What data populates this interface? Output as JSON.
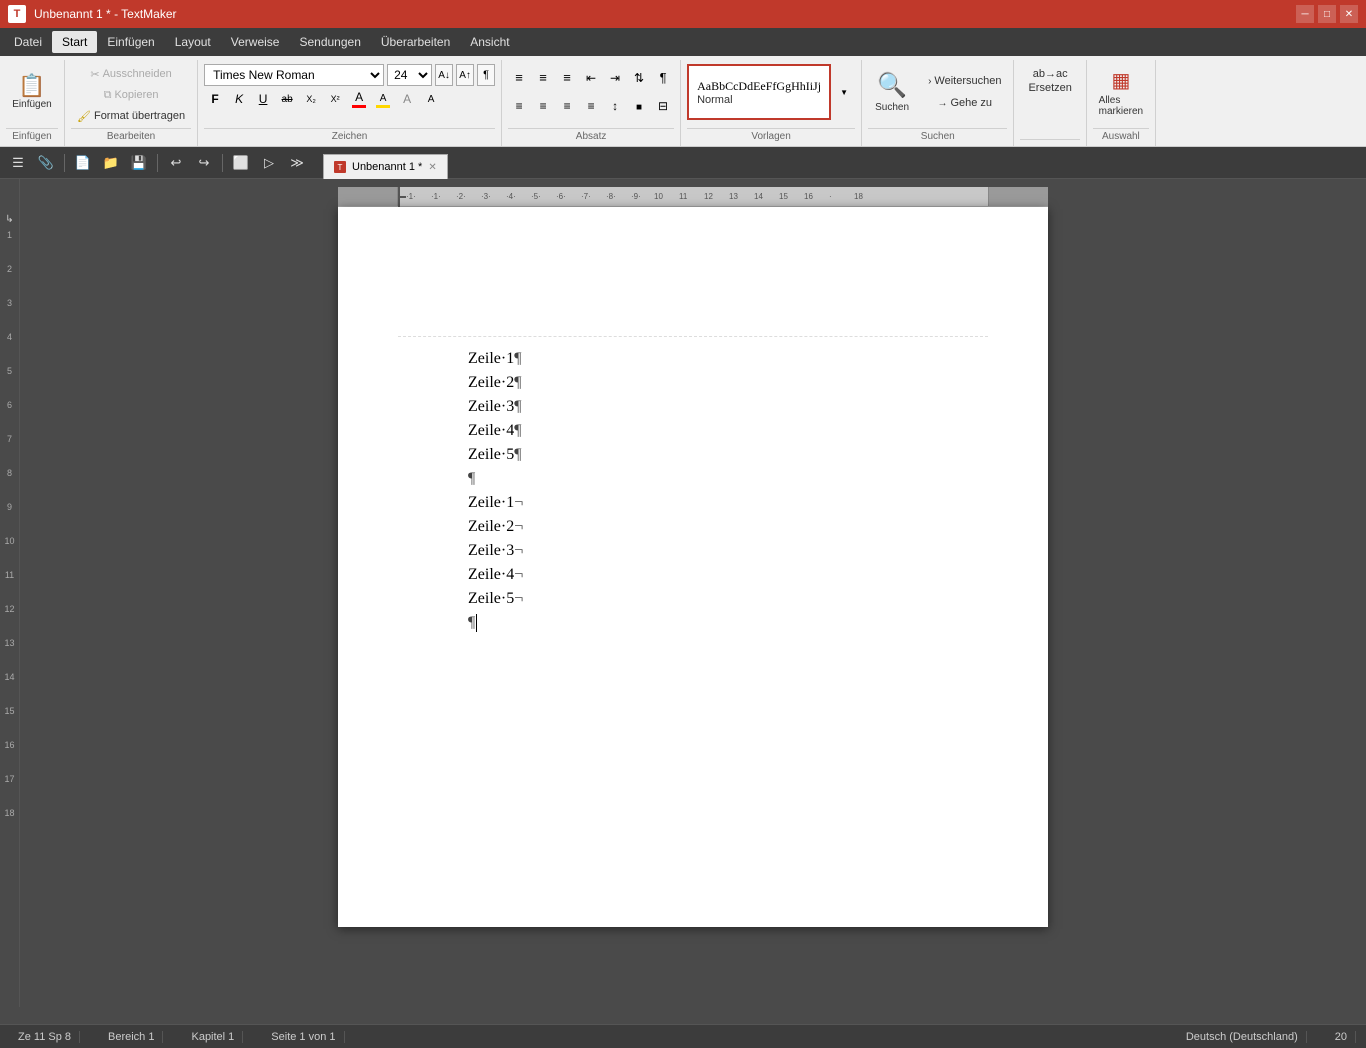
{
  "titleBar": {
    "appIcon": "T",
    "title": "Unbenannt 1 * - TextMaker",
    "minBtn": "─",
    "maxBtn": "□",
    "closeBtn": "✕"
  },
  "menuBar": {
    "items": [
      "Datei",
      "Start",
      "Einfügen",
      "Layout",
      "Verweise",
      "Sendungen",
      "Überarbeiten",
      "Ansicht"
    ],
    "activeIndex": 1
  },
  "ribbon": {
    "groups": [
      {
        "label": "Einfügen",
        "buttons": [
          {
            "icon": "📋",
            "label": "Einfügen"
          }
        ]
      },
      {
        "label": "Bearbeiten",
        "buttons": [
          {
            "label": "Ausschneiden",
            "disabled": true
          },
          {
            "label": "Kopieren",
            "disabled": true
          },
          {
            "label": "Format übertragen"
          }
        ]
      },
      {
        "label": "Zeichen",
        "fontName": "Times New Roman",
        "fontSize": "24",
        "formatButtons": [
          "F",
          "K",
          "U",
          "ab",
          "X₂",
          "X²",
          "A",
          "A",
          "A"
        ]
      },
      {
        "label": "Absatz",
        "alignButtons": [
          "≡",
          "≡",
          "≡",
          "≡"
        ]
      },
      {
        "label": "Vorlagen",
        "previewText": "AaBbCcDdEeFfGgHhIiJj",
        "previewLabel": "Normal"
      },
      {
        "label": "Suchen",
        "buttons": [
          "Suchen",
          "Weitersuchen",
          "Gehe zu"
        ]
      },
      {
        "label": "Auswahl",
        "buttons": [
          "Alles markieren"
        ]
      }
    ]
  },
  "toolbar": {
    "buttons": [
      "☰",
      "📎",
      "📄",
      "📁",
      "💾",
      "↩",
      "↪",
      "⬜",
      "▷",
      "≫"
    ]
  },
  "tabBar": {
    "tabs": [
      {
        "label": "Unbenannt 1 *",
        "active": true
      }
    ]
  },
  "document": {
    "lines": [
      {
        "text": "Zeile·1¶",
        "type": "pilcrow"
      },
      {
        "text": "Zeile·2¶",
        "type": "pilcrow"
      },
      {
        "text": "Zeile·3¶",
        "type": "pilcrow"
      },
      {
        "text": "Zeile·4¶",
        "type": "pilcrow"
      },
      {
        "text": "Zeile·5¶",
        "type": "pilcrow"
      },
      {
        "text": "¶",
        "type": "pilcrow"
      },
      {
        "text": "Zeile·1¬",
        "type": "newline"
      },
      {
        "text": "Zeile·2¬",
        "type": "newline"
      },
      {
        "text": "Zeile·3¬",
        "type": "newline"
      },
      {
        "text": "Zeile·4¬",
        "type": "newline"
      },
      {
        "text": "Zeile·5¬",
        "type": "newline"
      },
      {
        "text": "¶",
        "type": "pilcrow",
        "hasCursor": true
      }
    ]
  },
  "statusBar": {
    "position": "Ze 11 Sp 8",
    "section": "Bereich 1",
    "chapter": "Kapitel 1",
    "pages": "Seite 1 von 1",
    "language": "Deutsch (Deutschland)",
    "zoom": "20"
  },
  "ruler": {
    "marks": [
      "-1",
      "·1·",
      "·1·",
      "·2·",
      "·3·",
      "·4·",
      "·5·",
      "·6·",
      "·7·",
      "·8·",
      "·9·",
      "10",
      "11",
      "12",
      "13",
      "14",
      "15",
      "16",
      "·",
      "18"
    ],
    "verticalMarks": [
      "",
      "1",
      "2",
      "3",
      "4",
      "5",
      "6",
      "7",
      "8",
      "9",
      "10",
      "11",
      "12",
      "13",
      "14",
      "15",
      "16",
      "17",
      "18"
    ]
  }
}
